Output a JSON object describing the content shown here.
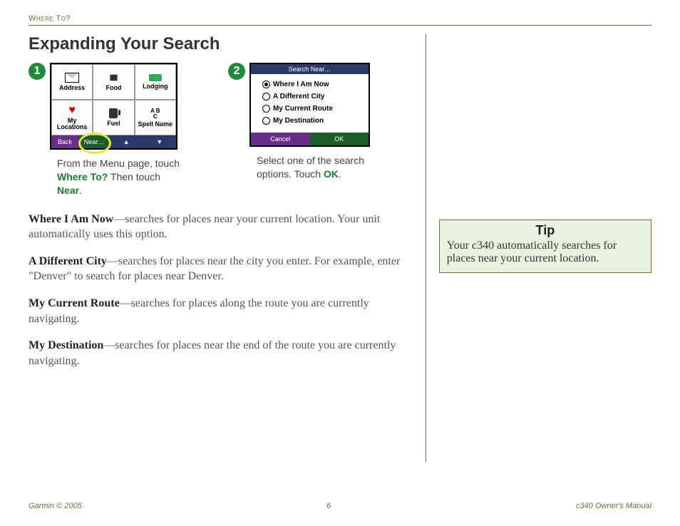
{
  "header": {
    "section": "Where To?"
  },
  "title": "Expanding Your Search",
  "steps": [
    {
      "num": "1",
      "caption_pre": "From the Menu page, touch ",
      "caption_kw1": "Where To?",
      "caption_mid": " Then touch ",
      "caption_kw2": "Near",
      "caption_post": "."
    },
    {
      "num": "2",
      "caption_pre": "Select one of the search options. Touch ",
      "caption_kw1": "OK",
      "caption_post": "."
    }
  ],
  "shot1": {
    "cells": [
      "Address",
      "Food",
      "Lodging",
      "My Locations",
      "Fuel",
      "Spell Name"
    ],
    "back": "Back",
    "near": "Near…",
    "up": "▲",
    "down": "▼"
  },
  "shot2": {
    "title": "Search Near…",
    "options": [
      "Where I Am Now",
      "A Different City",
      "My Current Route",
      "My Destination"
    ],
    "cancel": "Cancel",
    "ok": "OK"
  },
  "body": [
    {
      "term": "Where I Am Now",
      "text": "—searches for places near your current location. Your unit automatically uses this option."
    },
    {
      "term": "A Different City",
      "text": "—searches for places near the city you enter. For example, enter \"Denver\" to search for places near Denver."
    },
    {
      "term": "My Current Route",
      "text": "—searches for places along the route you are currently navigating."
    },
    {
      "term": "My Destination",
      "text": "—searches for places near the end of the route you are currently navigating."
    }
  ],
  "tip": {
    "title": "Tip",
    "text": "Your c340 automatically searches for places near your current location."
  },
  "footer": {
    "left": "Garmin © 2005",
    "center": "6",
    "right": "c340 Owner's Manual"
  }
}
